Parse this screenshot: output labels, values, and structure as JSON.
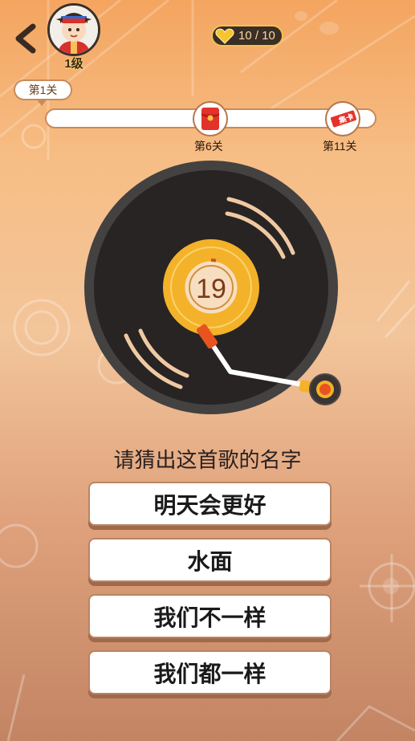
{
  "header": {
    "back_icon": "chevron-left-icon",
    "avatar_icon": "cartoon-avatar-icon",
    "level_label": "1级",
    "lives_text": "10 / 10",
    "lives_icon": "heart-icon"
  },
  "progress": {
    "current_stage_label": "第1关",
    "milestones": [
      {
        "label": "第6关",
        "icon": "red-envelope-icon"
      },
      {
        "label": "第11关",
        "icon": "collect-card-icon",
        "card_text": "集卡"
      }
    ]
  },
  "record": {
    "countdown": "19",
    "icon": "vinyl-record-icon"
  },
  "question": {
    "prompt": "请猜出这首歌的名字",
    "options": [
      "明天会更好",
      "水面",
      "我们不一样",
      "我们都一样"
    ]
  },
  "colors": {
    "accent": "#f3b224",
    "record": "#2e2a29",
    "tonearm_tip": "#e8531f",
    "option_border": "#b88466"
  }
}
